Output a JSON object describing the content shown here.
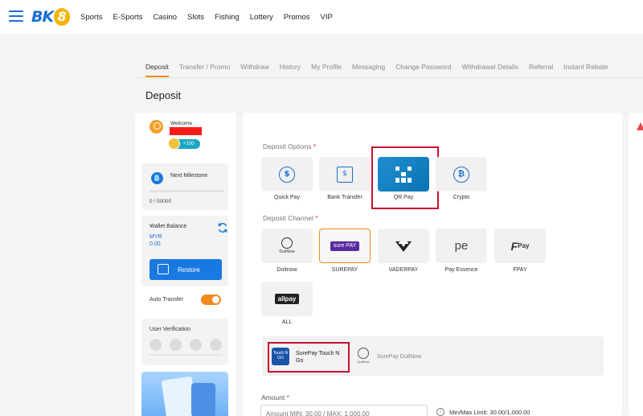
{
  "header": {
    "logo_text": "BK",
    "logo_num": "8",
    "nav": [
      "Sports",
      "E-Sports",
      "Casino",
      "Slots",
      "Fishing",
      "Lottery",
      "Promos",
      "VIP"
    ]
  },
  "tabs": [
    {
      "label": "Deposit",
      "active": true
    },
    {
      "label": "Transfer / Promo"
    },
    {
      "label": "Withdraw"
    },
    {
      "label": "History"
    },
    {
      "label": "My Profile"
    },
    {
      "label": "Messaging"
    },
    {
      "label": "Change Password"
    },
    {
      "label": "Withdrawal Details"
    },
    {
      "label": "Referral"
    },
    {
      "label": "Instant Rebate"
    }
  ],
  "page_title": "Deposit",
  "sidebar": {
    "welcome": "Welcome",
    "badge": "+100",
    "milestone_label": "Next Milestone",
    "milestone_value": "0 / 50000",
    "wallet_label": "Wallet Balance",
    "wallet_currency": "MYR",
    "wallet_value": "0.00",
    "restore_label": "Restore",
    "auto_transfer_label": "Auto Transfer",
    "auto_transfer_on": true,
    "verification_label": "User Verification"
  },
  "deposit": {
    "options_label": "Deposit Options",
    "options": [
      {
        "label": "Quick Pay",
        "icon": "quick-pay-icon"
      },
      {
        "label": "Bank Transfer",
        "icon": "bank-icon"
      },
      {
        "label": "QR Pay",
        "icon": "qr-icon",
        "selected": true
      },
      {
        "label": "Crypto",
        "icon": "bitcoin-icon"
      }
    ],
    "channel_label": "Deposit Channel",
    "channels": [
      {
        "label": "Doitnow",
        "logo": "DuitNow"
      },
      {
        "label": "SUREPAY",
        "logo": "sure PAY",
        "selected": true
      },
      {
        "label": "VADERPAY",
        "logo": ""
      },
      {
        "label": "Pay Essence",
        "logo": "pe"
      },
      {
        "label": "FPAY",
        "logo": "Pay"
      },
      {
        "label": "ALL",
        "logo": "allpay"
      }
    ],
    "methods": [
      {
        "label": "SurePay Touch N Go",
        "logo": "Touch N GO"
      },
      {
        "label": "SurePay DuitNow",
        "logo": "DuitNow"
      }
    ],
    "amount_label": "Amount",
    "amount_placeholder": "Amount MIN: 30.00 / MAX: 1,000.00",
    "minmax": "Min/Max Limit: 30.00/1,000.00",
    "required_mark": "*"
  }
}
